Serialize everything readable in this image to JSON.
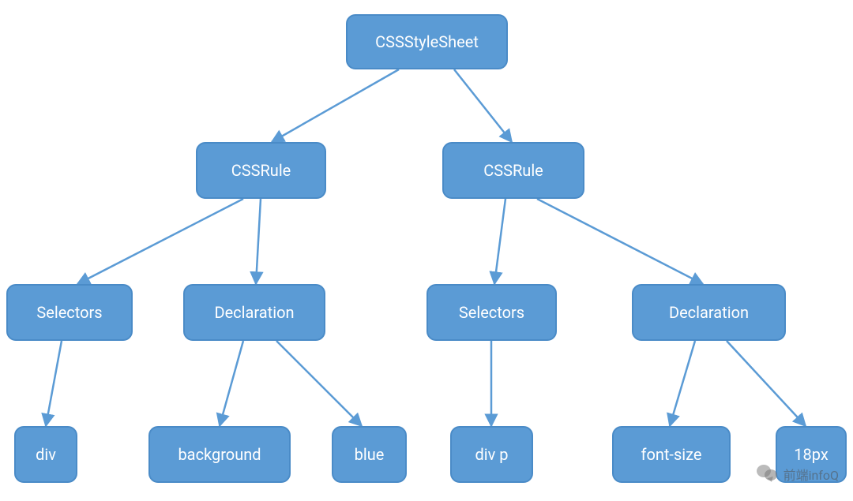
{
  "diagram": {
    "nodes": {
      "root": "CSSStyleSheet",
      "rule1": "CSSRule",
      "rule2": "CSSRule",
      "sel1": "Selectors",
      "decl1": "Declaration",
      "sel2": "Selectors",
      "decl2": "Declaration",
      "leaf_div": "div",
      "leaf_background": "background",
      "leaf_blue": "blue",
      "leaf_divp": "div p",
      "leaf_fontsize": "font-size",
      "leaf_18px": "18px"
    },
    "edges": [
      [
        "root",
        "rule1"
      ],
      [
        "root",
        "rule2"
      ],
      [
        "rule1",
        "sel1"
      ],
      [
        "rule1",
        "decl1"
      ],
      [
        "rule2",
        "sel2"
      ],
      [
        "rule2",
        "decl2"
      ],
      [
        "sel1",
        "leaf_div"
      ],
      [
        "decl1",
        "leaf_background"
      ],
      [
        "decl1",
        "leaf_blue"
      ],
      [
        "sel2",
        "leaf_divp"
      ],
      [
        "decl2",
        "leaf_fontsize"
      ],
      [
        "decl2",
        "leaf_18px"
      ]
    ]
  },
  "colors": {
    "node_fill": "#5b9bd5",
    "node_border": "#4a8bc7",
    "edge": "#5b9bd5"
  },
  "watermark": {
    "text": "前端infoQ"
  }
}
